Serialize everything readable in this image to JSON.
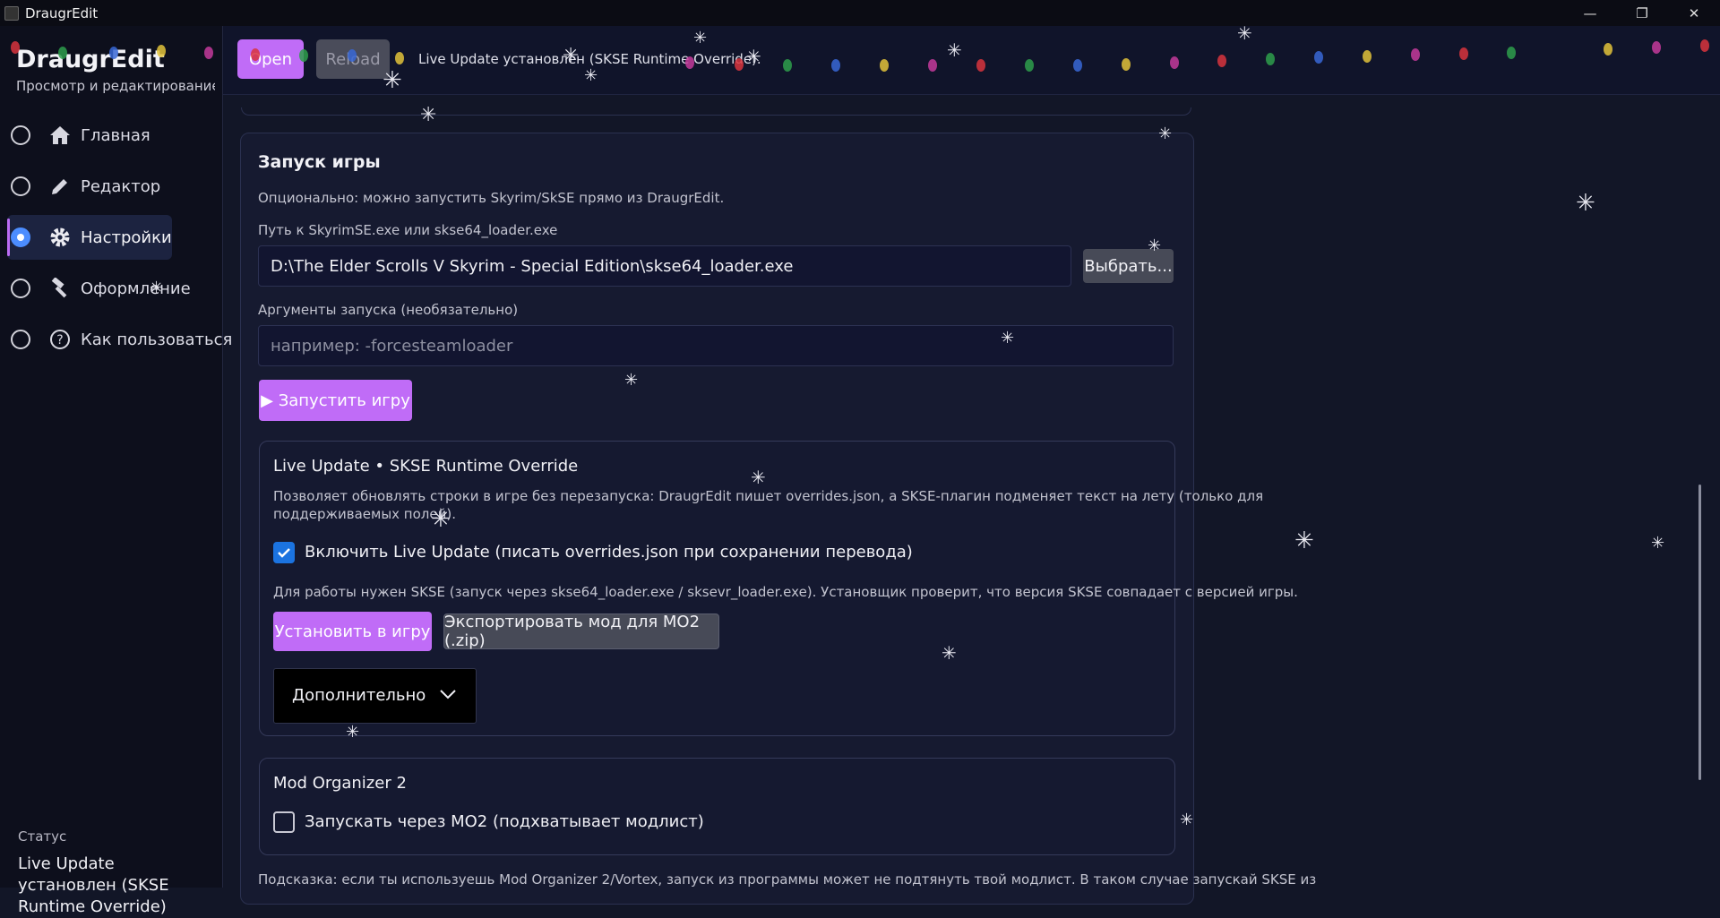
{
  "window": {
    "title": "DraugrEdit",
    "minimize": "—",
    "maximize": "❐",
    "close": "✕"
  },
  "sidebar": {
    "brand": "DraugrEdit",
    "tagline": "Просмотр и редактирование ст",
    "items": [
      {
        "label": "Главная",
        "icon": "home-icon",
        "selected": false
      },
      {
        "label": "Редактор",
        "icon": "pencil-icon",
        "selected": false
      },
      {
        "label": "Настройки",
        "icon": "gear-icon",
        "selected": true
      },
      {
        "label": "Оформление",
        "icon": "hammer-icon",
        "selected": false
      },
      {
        "label": "Как пользоваться",
        "icon": "help-icon",
        "selected": false
      }
    ],
    "status_label": "Статус",
    "status_text": "Live Update установлен (SKSE Runtime Override)"
  },
  "toolbar": {
    "open_label": "Open",
    "reload_label": "Reload",
    "status": "Live Update установлен (SKSE Runtime Override)."
  },
  "launch": {
    "title": "Запуск игры",
    "description": "Опционально: можно запустить Skyrim/SkSE прямо из DraugrEdit.",
    "path_label": "Путь к SkyrimSE.exe или skse64_loader.exe",
    "path_value": "D:\\The Elder Scrolls V Skyrim - Special Edition\\skse64_loader.exe",
    "browse_label": "Выбрать...",
    "args_label": "Аргументы запуска (необязательно)",
    "args_placeholder": "например: -forcesteamloader",
    "run_label": "▶ Запустить игру"
  },
  "live_update": {
    "title": "Live Update • SKSE Runtime Override",
    "description_1": "Позволяет обновлять строки в игре без перезапуска: DraugrEdit пишет overrides.json, а SKSE-плагин подменяет текст на лету (только для",
    "description_2": "поддерживаемых полей).",
    "enable_label": "Включить Live Update (писать overrides.json при сохранении перевода)",
    "enable_checked": true,
    "note": "Для работы нужен SKSE (запуск через skse64_loader.exe / sksevr_loader.exe). Установщик проверит, что версия SKSE совпадает с версией игры.",
    "install_label": "Установить в игру",
    "export_label": "Экспортировать мод для MO2 (.zip)",
    "advanced_label": "Дополнительно"
  },
  "mo2": {
    "title": "Mod Organizer 2",
    "launch_label": "Запускать через MO2 (подхватывает модлист)",
    "launch_checked": false
  },
  "hint": "Подсказка: если ты используешь Mod Organizer 2/Vortex, запуск из программы может не подтянуть твой модлист. В таком случае запускай SKSE из",
  "colors": {
    "accent": "#c06cf7",
    "checkbox": "#1b73e0",
    "background": "#121627"
  }
}
